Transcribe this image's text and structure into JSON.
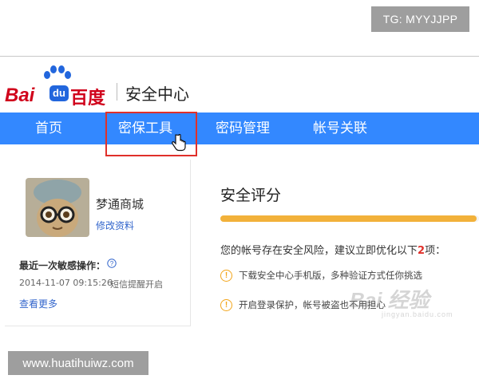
{
  "overlay": {
    "tg_badge": "TG: MYYJJPP",
    "site_badge": "www.huatihuiwz.com"
  },
  "header": {
    "logo_bai": "Bai",
    "logo_du": "du",
    "logo_baidu_cn": "百度",
    "title": "安全中心"
  },
  "nav": {
    "items": [
      {
        "label": "首页"
      },
      {
        "label": "密保工具"
      },
      {
        "label": "密码管理"
      },
      {
        "label": "帐号关联"
      }
    ],
    "highlighted_index": 1
  },
  "profile": {
    "username": "梦通商城",
    "edit_link": "修改资料",
    "recent_label": "最近一次敏感操作：",
    "recent_time": "2014-11-07 09:15:26",
    "recent_event": "短信提醒开启",
    "view_more": "查看更多"
  },
  "score": {
    "title": "安全评分",
    "level": 0.99,
    "risk_prefix": "您的帐号存在安全风险，建议立即优化以下",
    "risk_count": "2",
    "risk_suffix": "项：",
    "tips": [
      {
        "text": "下载安全中心手机版，多种验证方式任你挑选"
      },
      {
        "text": "开启登录保护，帐号被盗也不用担心"
      }
    ]
  },
  "watermark": {
    "big": "Bai 经验",
    "small": "jingyan.baidu.com"
  },
  "colors": {
    "nav_blue": "#3388ff",
    "baidu_red": "#d0021b",
    "score_orange": "#f2b13a",
    "highlight_red": "#e0302a",
    "link_blue": "#3366cc"
  }
}
